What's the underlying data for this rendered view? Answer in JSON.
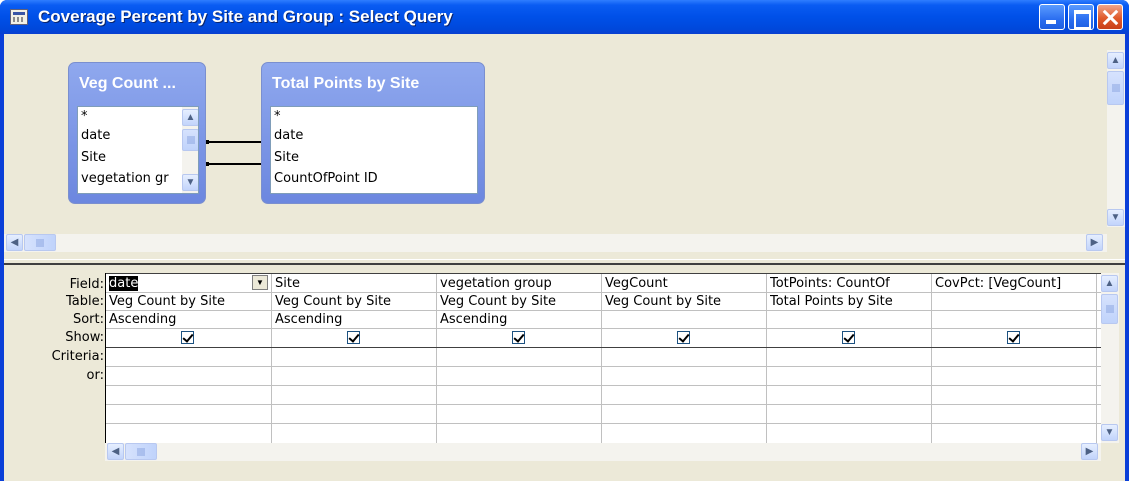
{
  "window": {
    "title": "Coverage Percent by Site and Group : Select Query"
  },
  "field_lists": [
    {
      "title": "Veg Count ...",
      "fields": [
        "*",
        "date",
        "Site",
        "vegetation gr"
      ]
    },
    {
      "title": "Total Points by Site",
      "fields": [
        "*",
        "date",
        "Site",
        "CountOfPoint ID"
      ]
    }
  ],
  "grid": {
    "row_labels": {
      "field": "Field:",
      "table": "Table:",
      "sort": "Sort:",
      "show": "Show:",
      "criteria": "Criteria:",
      "or": "or:"
    },
    "columns": [
      {
        "field": "date",
        "table": "Veg Count by Site",
        "sort": "Ascending",
        "show": true
      },
      {
        "field": "Site",
        "table": "Veg Count by Site",
        "sort": "Ascending",
        "show": true
      },
      {
        "field": "vegetation group",
        "table": "Veg Count by Site",
        "sort": "Ascending",
        "show": true
      },
      {
        "field": "VegCount",
        "table": "Veg Count by Site",
        "sort": "",
        "show": true
      },
      {
        "field": "TotPoints: CountOf",
        "table": "Total Points by Site",
        "sort": "",
        "show": true
      },
      {
        "field": "CovPct: [VegCount]",
        "table": "",
        "sort": "",
        "show": true
      }
    ]
  }
}
